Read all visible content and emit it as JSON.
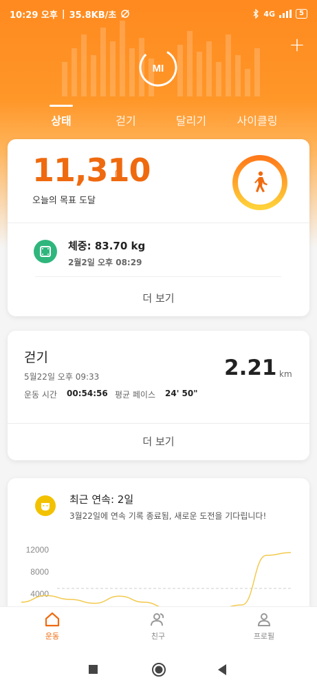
{
  "status_bar": {
    "time": "10:29 오후",
    "speed": "35.8KB/초",
    "network": "4G",
    "battery": "5"
  },
  "top_tabs": [
    {
      "label": "상태",
      "active": true
    },
    {
      "label": "걷기",
      "active": false
    },
    {
      "label": "달리기",
      "active": false
    },
    {
      "label": "사이클링",
      "active": false
    }
  ],
  "logo_text": "MI",
  "summary": {
    "steps": "11,310",
    "goal_label": "오늘의 목표 도달",
    "weight_title": "체중: 83.70 kg",
    "weight_date": "2월2일 오후 08:29",
    "more_label": "더 보기"
  },
  "walk": {
    "title": "걷기",
    "date": "5월22일 오후 09:33",
    "duration_label": "운동 시간",
    "duration_value": "00:54:56",
    "pace_label": "평균 페이스",
    "pace_value": "24' 50\"",
    "distance": "2.21",
    "unit": "km",
    "more_label": "더 보기"
  },
  "streak": {
    "title": "최근 연속: 2일",
    "subtitle": "3월22일에 연속 기록 종료됨, 새로운 도전을 기다립니다!"
  },
  "chart_data": {
    "type": "line",
    "y_ticks": [
      "12000",
      "8000",
      "4000"
    ],
    "ylim": [
      0,
      12000
    ],
    "goal_line": 5000,
    "values": [
      2500,
      3700,
      3000,
      2300,
      3600,
      2500,
      1400,
      1400,
      1300,
      2000,
      11000,
      11500
    ],
    "color": "#f2c94c"
  },
  "bottom_nav": [
    {
      "label": "운동",
      "active": true,
      "icon": "home-icon"
    },
    {
      "label": "친구",
      "active": false,
      "icon": "friends-icon"
    },
    {
      "label": "프로필",
      "active": false,
      "icon": "profile-icon"
    }
  ],
  "colors": {
    "accent": "#ef6a0f",
    "header": "#ff8a1f",
    "weight_icon": "#2fb67c",
    "streak_icon": "#f2c200"
  }
}
